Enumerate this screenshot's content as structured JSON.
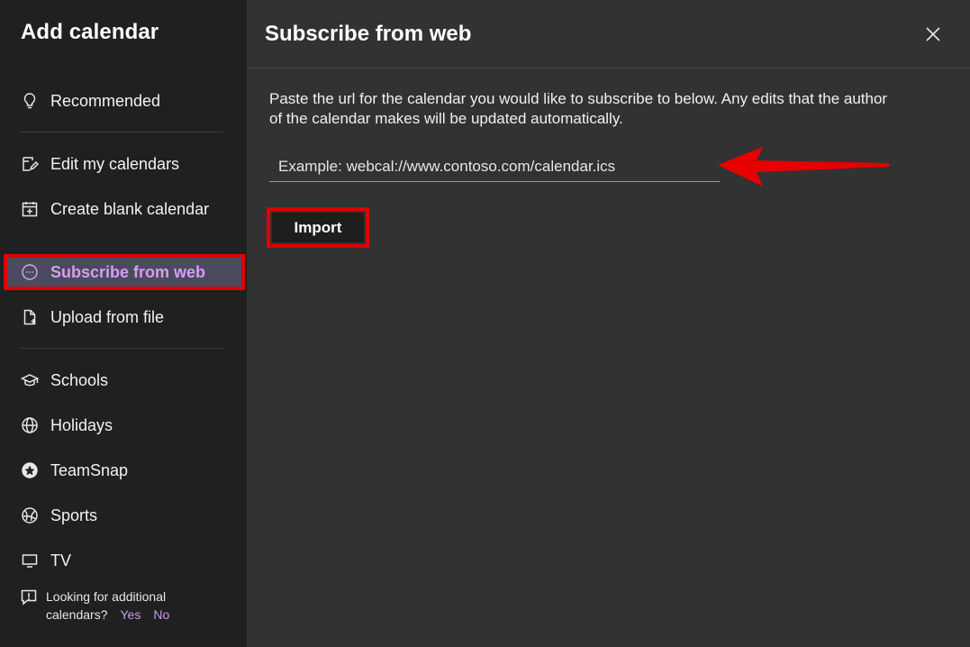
{
  "sidebar": {
    "title": "Add calendar",
    "items": [
      {
        "label": "Recommended",
        "icon": "lightbulb-icon"
      },
      {
        "label": "Edit my calendars",
        "icon": "edit-icon"
      },
      {
        "label": "Create blank calendar",
        "icon": "calendar-add-icon"
      },
      {
        "label": "Subscribe from web",
        "icon": "web-link-icon",
        "selected": true
      },
      {
        "label": "Upload from file",
        "icon": "file-upload-icon"
      },
      {
        "label": "Schools",
        "icon": "graduation-cap-icon"
      },
      {
        "label": "Holidays",
        "icon": "globe-icon"
      },
      {
        "label": "TeamSnap",
        "icon": "teamsnap-icon"
      },
      {
        "label": "Sports",
        "icon": "sports-ball-icon"
      },
      {
        "label": "TV",
        "icon": "tv-icon"
      }
    ],
    "feedback": {
      "text_line1": "Looking for additional",
      "text_line2": "calendars?",
      "yes": "Yes",
      "no": "No"
    }
  },
  "panel": {
    "title": "Subscribe from web",
    "description": "Paste the url for the calendar you would like to subscribe to below. Any edits that the author of the calendar makes will be updated automatically.",
    "url_placeholder": "Example: webcal://www.contoso.com/calendar.ics",
    "import_label": "Import"
  },
  "colors": {
    "sidebar_bg": "#202020",
    "panel_bg": "#323232",
    "accent": "#d49ff0",
    "highlight": "#e00000"
  }
}
